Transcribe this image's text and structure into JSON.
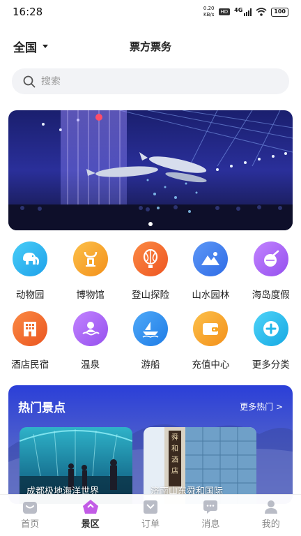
{
  "status": {
    "time": "16:28",
    "net_speed_value": "0.20",
    "net_speed_unit": "KB/s",
    "hd": "HD",
    "network": "4G",
    "battery": "100"
  },
  "header": {
    "region": "全国",
    "title": "票方票务"
  },
  "search": {
    "placeholder": "搜索"
  },
  "banner": {
    "dots": 1,
    "active_dot": 0
  },
  "categories": [
    {
      "label": "动物园",
      "icon": "elephant-icon",
      "color": "#2ab7f0"
    },
    {
      "label": "博物馆",
      "icon": "museum-icon",
      "color": "#f7a21c"
    },
    {
      "label": "登山探险",
      "icon": "balloon-icon",
      "color": "#f36a2b"
    },
    {
      "label": "山水园林",
      "icon": "mountain-icon",
      "color": "#3e7ff0"
    },
    {
      "label": "海岛度假",
      "icon": "coconut-icon",
      "color": "#a45ff0"
    },
    {
      "label": "酒店民宿",
      "icon": "hotel-icon",
      "color": "#f06b2b"
    },
    {
      "label": "温泉",
      "icon": "hot-spring-icon",
      "color": "#a45ff0"
    },
    {
      "label": "游船",
      "icon": "boat-icon",
      "color": "#2b8ef0"
    },
    {
      "label": "充值中心",
      "icon": "wallet-icon",
      "color": "#f7a21c"
    },
    {
      "label": "更多分类",
      "icon": "plus-icon",
      "color": "#22b6e8"
    }
  ],
  "hot": {
    "title": "热门景点",
    "more": "更多热门 >",
    "cards": [
      {
        "caption": "成都极地海洋世界"
      },
      {
        "caption": "济南山东舜和国际"
      }
    ]
  },
  "tabs": [
    {
      "label": "首页",
      "icon": "home-icon",
      "active": false
    },
    {
      "label": "景区",
      "icon": "scenic-icon",
      "active": true
    },
    {
      "label": "订单",
      "icon": "order-icon",
      "active": false
    },
    {
      "label": "消息",
      "icon": "message-icon",
      "active": false
    },
    {
      "label": "我的",
      "icon": "profile-icon",
      "active": false
    }
  ]
}
